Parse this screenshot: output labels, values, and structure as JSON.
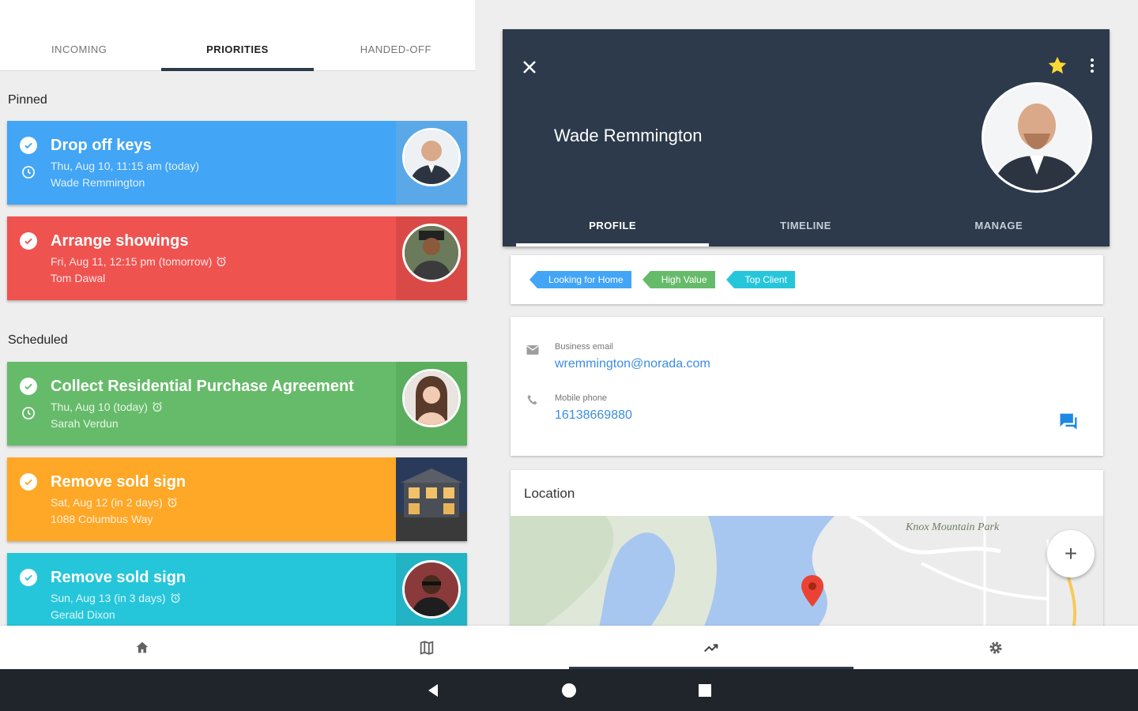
{
  "colors": {
    "blue": "#42a5f5",
    "red": "#ef5350",
    "green": "#66bb6a",
    "orange": "#ffa726",
    "cyan": "#26c6da",
    "header": "#2c3a4b",
    "link": "#3b8ede"
  },
  "left_tabs": [
    {
      "label": "INCOMING",
      "active": false
    },
    {
      "label": "PRIORITIES",
      "active": true
    },
    {
      "label": "HANDED-OFF",
      "active": false
    }
  ],
  "sections": {
    "pinned": "Pinned",
    "scheduled": "Scheduled"
  },
  "tasks": [
    {
      "title": "Drop off keys",
      "when": "Thu, Aug 10, 11:15 am  (today)",
      "who": "Wade Remmington",
      "color": "blue",
      "icon": "clock-icon"
    },
    {
      "title": "Arrange showings",
      "when": "Fri, Aug 11, 12:15 pm  (tomorrow)",
      "who": "Tom Dawal",
      "color": "red",
      "icon": "alarm-icon"
    },
    {
      "title": "Collect Residential Purchase Agreement",
      "when": "Thu, Aug 10  (today)",
      "who": "Sarah Verdun",
      "color": "green",
      "icon": "alarm-icon"
    },
    {
      "title": "Remove sold sign",
      "when": "Sat, Aug 12  (in 2 days)",
      "who": "1088 Columbus Way",
      "color": "orange",
      "icon": "alarm-icon"
    },
    {
      "title": "Remove sold sign",
      "when": "Sun, Aug 13  (in 3 days)",
      "who": "Gerald Dixon",
      "color": "cyan",
      "icon": "alarm-icon"
    }
  ],
  "profile": {
    "name": "Wade Remmington",
    "tabs": [
      {
        "label": "PROFILE",
        "active": true
      },
      {
        "label": "TIMELINE",
        "active": false
      },
      {
        "label": "MANAGE",
        "active": false
      }
    ],
    "tags": [
      {
        "label": "Looking for Home",
        "color": "#42a5f5"
      },
      {
        "label": "High Value",
        "color": "#66bb6a"
      },
      {
        "label": "Top Client",
        "color": "#26c6da"
      }
    ],
    "email_label": "Business email",
    "email": "wremmington@norada.com",
    "phone_label": "Mobile phone",
    "phone": "16138669880",
    "location_label": "Location",
    "map_labels": {
      "park": "Knox Mountain Park"
    },
    "fab": "+"
  },
  "bottom_nav": [
    "home-icon",
    "map-icon",
    "trending-up-icon",
    "settings-icon"
  ]
}
